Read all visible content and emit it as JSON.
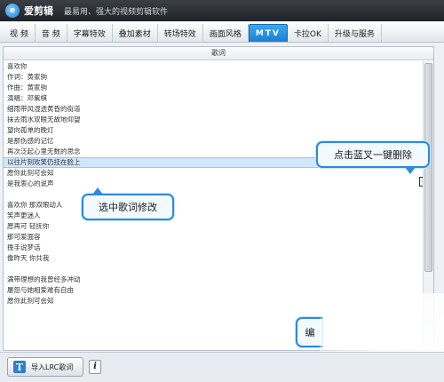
{
  "titlebar": {
    "logo_char": "e",
    "app_name": "爱剪辑",
    "slogan": "最易用、强大的视频剪辑软件"
  },
  "tabs": [
    {
      "label": "视  频",
      "active": false
    },
    {
      "label": "音  频",
      "active": false
    },
    {
      "label": "字幕特效",
      "active": false
    },
    {
      "label": "叠加素材",
      "active": false
    },
    {
      "label": "转场特效",
      "active": false
    },
    {
      "label": "画面风格",
      "active": false
    },
    {
      "label": "MTV",
      "active": true
    },
    {
      "label": "卡拉OK",
      "active": false
    },
    {
      "label": "升级与服务",
      "active": false
    }
  ],
  "panel": {
    "header": "歌词",
    "lyrics": [
      "喜欢你",
      "作词：黄家驹",
      "作曲：黄家驹",
      "演唱：邓紫棋",
      "细雨带风湿透黄昏的街道",
      "抹去雨水双眼无故地仰望",
      "望向孤单的晚灯",
      "是那伤感的记忆",
      "再次泛起心里无数的思念",
      "以往片刻欢笑仍挂在脸上",
      "愿你此刻可会知",
      "是我衷心的说声",
      "",
      "喜欢你  那双眼动人",
      "笑声更迷人",
      "愿再可  轻抚你",
      "那可爱面容",
      "挽手说梦话",
      "像昨天  你共我",
      "",
      "满带理想的我曾经多冲动",
      "屡怨与她相爱难有自由",
      "愿你此刻可会知"
    ],
    "selected_index": 9
  },
  "callouts": {
    "delete_hint": "点击蓝叉一键删除",
    "edit_hint": "选中歌词修改",
    "partial_hint": "编"
  },
  "delete_button": {
    "glyph": "✕"
  },
  "footer": {
    "import_icon": "T",
    "import_label": "导入LRC歌词",
    "info_icon": "i"
  }
}
